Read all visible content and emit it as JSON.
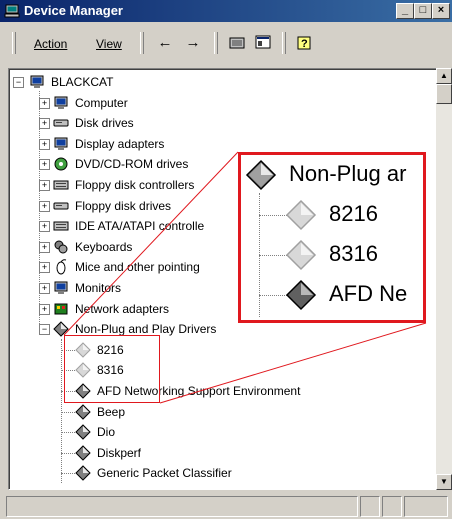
{
  "window": {
    "title": "Device Manager",
    "buttons": {
      "minimize": "_",
      "maximize": "□",
      "close": "×"
    }
  },
  "menu": {
    "action_label": "Action",
    "view_label": "View"
  },
  "tree": {
    "root": "BLACKCAT",
    "items": [
      {
        "label": "Computer",
        "icon": "computer-icon"
      },
      {
        "label": "Disk drives",
        "icon": "disk-drive-icon"
      },
      {
        "label": "Display adapters",
        "icon": "monitor-icon"
      },
      {
        "label": "DVD/CD-ROM drives",
        "icon": "cdrom-icon"
      },
      {
        "label": "Floppy disk controllers",
        "icon": "controller-icon"
      },
      {
        "label": "Floppy disk drives",
        "icon": "floppy-icon"
      },
      {
        "label": "IDE ATA/ATAPI controlle",
        "icon": "controller-icon"
      },
      {
        "label": "Keyboards",
        "icon": "keyboard-icon"
      },
      {
        "label": "Mice and other pointing",
        "icon": "mouse-icon"
      },
      {
        "label": "Monitors",
        "icon": "monitor-icon"
      },
      {
        "label": "Network adapters",
        "icon": "network-icon"
      },
      {
        "label": "Non-Plug and Play Drivers",
        "icon": "driver-icon"
      }
    ],
    "children": [
      {
        "label": "8216",
        "icon": "driver-disabled-icon"
      },
      {
        "label": "8316",
        "icon": "driver-disabled-icon"
      },
      {
        "label": "AFD Networking Support Environment",
        "icon": "driver-icon"
      },
      {
        "label": "Beep",
        "icon": "driver-icon"
      },
      {
        "label": "Dio",
        "icon": "driver-icon"
      },
      {
        "label": "Diskperf",
        "icon": "driver-icon"
      },
      {
        "label": "Generic Packet Classifier",
        "icon": "driver-icon"
      }
    ]
  },
  "zoom": {
    "lines": [
      "Non-Plug ar",
      "8216",
      "8316",
      "AFD Ne"
    ]
  },
  "colors": {
    "highlight": "#e0181e",
    "titlebar": "#0a246a"
  }
}
